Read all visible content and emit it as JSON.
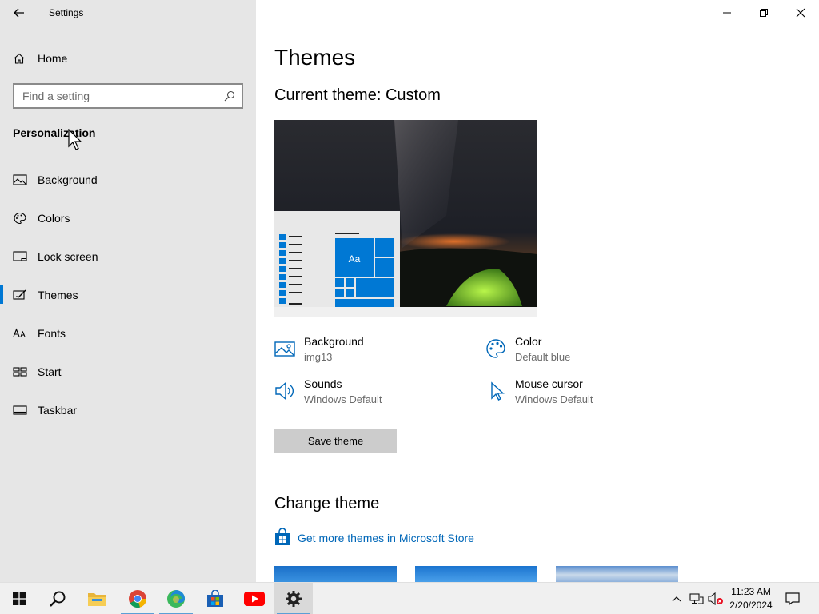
{
  "window": {
    "title": "Settings",
    "controls": [
      "minimize",
      "restore",
      "close"
    ]
  },
  "sidebar": {
    "home_label": "Home",
    "search_placeholder": "Find a setting",
    "section": "Personalization",
    "items": [
      {
        "label": "Background",
        "icon": "image-icon",
        "selected": false
      },
      {
        "label": "Colors",
        "icon": "palette-icon",
        "selected": false
      },
      {
        "label": "Lock screen",
        "icon": "lock-screen-icon",
        "selected": false
      },
      {
        "label": "Themes",
        "icon": "themes-icon",
        "selected": true
      },
      {
        "label": "Fonts",
        "icon": "fonts-icon",
        "selected": false
      },
      {
        "label": "Start",
        "icon": "start-icon",
        "selected": false
      },
      {
        "label": "Taskbar",
        "icon": "taskbar-icon",
        "selected": false
      }
    ]
  },
  "main": {
    "title": "Themes",
    "current_theme_label": "Current theme: Custom",
    "properties": {
      "background": {
        "name": "Background",
        "value": "img13"
      },
      "color": {
        "name": "Color",
        "value": "Default blue"
      },
      "sounds": {
        "name": "Sounds",
        "value": "Windows Default"
      },
      "mouse_cursor": {
        "name": "Mouse cursor",
        "value": "Windows Default"
      }
    },
    "save_button": "Save theme",
    "change_theme_label": "Change theme",
    "store_link": "Get more themes in Microsoft Store",
    "preview_tile_text": "Aa"
  },
  "taskbar": {
    "apps": [
      "start-button",
      "search-button",
      "file-explorer",
      "chrome",
      "edge",
      "microsoft-store",
      "youtube",
      "settings"
    ],
    "active_app": "settings",
    "time": "11:23 AM",
    "date": "2/20/2024"
  },
  "colors": {
    "accent": "#0078d4",
    "link": "#0067b8",
    "sidebar_bg": "#e6e6e6",
    "taskbar_bg": "#f0f0f0"
  }
}
